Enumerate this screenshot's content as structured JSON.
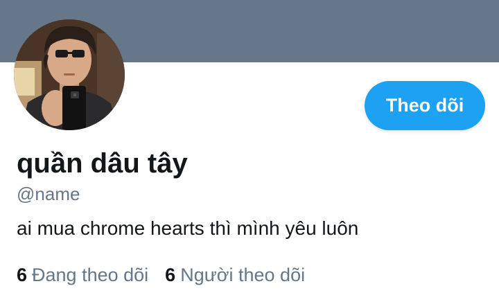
{
  "profile": {
    "display_name": "quần dâu tây",
    "handle": "@name",
    "bio": "ai mua chrome hearts thì mình yêu luôn",
    "follow_button_label": "Theo dõi"
  },
  "stats": {
    "following": {
      "count": "6",
      "label": "Đang theo dõi"
    },
    "followers": {
      "count": "6",
      "label": "Người theo dõi"
    }
  },
  "colors": {
    "banner": "#66778a",
    "accent": "#1da1f2",
    "text_primary": "#14171a",
    "text_secondary": "#657786"
  }
}
